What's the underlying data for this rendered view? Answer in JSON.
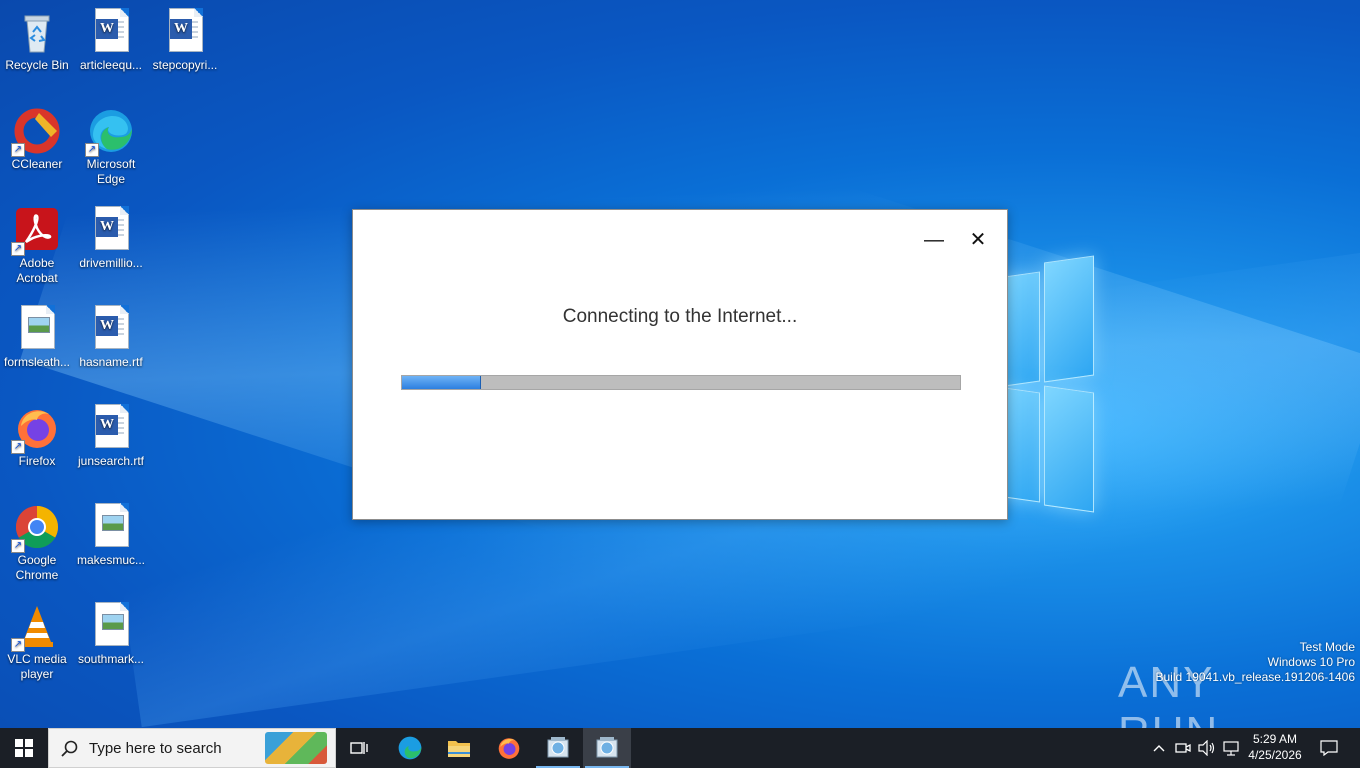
{
  "desktop": {
    "icons": [
      {
        "label": "Recycle Bin"
      },
      {
        "label": "articleequ..."
      },
      {
        "label": "stepcopyri..."
      },
      {
        "label": "CCleaner"
      },
      {
        "label": "Microsoft Edge"
      },
      {
        "label": "Adobe Acrobat"
      },
      {
        "label": "drivemillio..."
      },
      {
        "label": "formsleath..."
      },
      {
        "label": "hasname.rtf"
      },
      {
        "label": "Firefox"
      },
      {
        "label": "junsearch.rtf"
      },
      {
        "label": "Google Chrome"
      },
      {
        "label": "makesmuc..."
      },
      {
        "label": "VLC media player"
      },
      {
        "label": "southmark..."
      }
    ],
    "watermark": {
      "line1": "Test Mode",
      "line2": "Windows 10 Pro",
      "line3": "Build 19041.vb_release.191206-1406"
    },
    "brand_text": "ANY RUN"
  },
  "dialog": {
    "message": "Connecting to the Internet...",
    "progress_fraction": 0.14,
    "minimize_glyph": "—",
    "close_glyph": "✕"
  },
  "taskbar": {
    "search_placeholder": "Type here to search",
    "apps": [
      "task-view-icon",
      "edge-icon",
      "file-explorer-icon",
      "firefox-icon",
      "setup-app-icon",
      "setup-app-icon-active"
    ],
    "clock_time": "5:29 AM",
    "clock_date": "4/25/2026"
  },
  "colors": {
    "taskbar_bg": "#1b1f26",
    "progress_fill": "#2c7fe0",
    "progress_track": "#bdbdbd"
  }
}
